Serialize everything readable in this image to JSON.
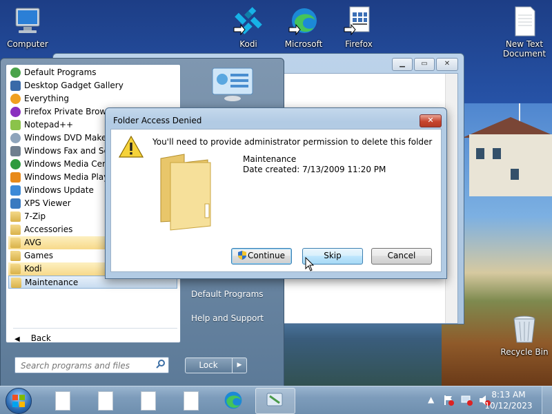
{
  "desktop": {
    "icons": [
      {
        "label": "Computer",
        "icon": "computer-icon"
      },
      {
        "label": "Kodi",
        "icon": "kodi-icon"
      },
      {
        "label": "Microsoft",
        "icon": "edge-icon"
      },
      {
        "label": "Firefox",
        "icon": "firefox-shortcut-icon"
      },
      {
        "label": "New Text Document",
        "icon": "text-document-icon"
      },
      {
        "label": "Recycle Bin",
        "icon": "recycle-bin-icon"
      }
    ]
  },
  "start_menu": {
    "items": [
      {
        "label": "Default Programs",
        "icon": "default-programs-icon"
      },
      {
        "label": "Desktop Gadget Gallery",
        "icon": "gadget-gallery-icon"
      },
      {
        "label": "Everything",
        "icon": "search-everything-icon"
      },
      {
        "label": "Firefox Private Browsing",
        "icon": "firefox-private-icon"
      },
      {
        "label": "Notepad++",
        "icon": "notepad-plus-icon"
      },
      {
        "label": "Windows DVD Maker",
        "icon": "dvd-maker-icon"
      },
      {
        "label": "Windows Fax and Scan",
        "icon": "fax-scan-icon"
      },
      {
        "label": "Windows Media Center",
        "icon": "media-center-icon"
      },
      {
        "label": "Windows Media Player",
        "icon": "media-player-icon"
      },
      {
        "label": "Windows Update",
        "icon": "windows-update-icon"
      },
      {
        "label": "XPS Viewer",
        "icon": "xps-viewer-icon"
      },
      {
        "label": "7-Zip",
        "icon": "folder-icon"
      },
      {
        "label": "Accessories",
        "icon": "folder-icon"
      },
      {
        "label": "AVG",
        "icon": "folder-icon"
      },
      {
        "label": "Games",
        "icon": "folder-icon"
      },
      {
        "label": "Kodi",
        "icon": "folder-icon"
      },
      {
        "label": "Maintenance",
        "icon": "folder-icon"
      }
    ],
    "back_label": "Back",
    "search_placeholder": "Search programs and files",
    "right_links": [
      "Default Programs",
      "Help and Support"
    ],
    "lock_label": "Lock"
  },
  "dialog": {
    "title": "Folder Access Denied",
    "close_label": "✕",
    "message": "You'll need to provide administrator permission to delete this folder",
    "folder_name": "Maintenance",
    "date_created": "Date created: 7/13/2009 11:20 PM",
    "buttons": {
      "continue": "Continue",
      "skip": "Skip",
      "cancel": "Cancel"
    }
  },
  "taskbar": {
    "time": "8:13 AM",
    "date": "10/12/2023"
  }
}
